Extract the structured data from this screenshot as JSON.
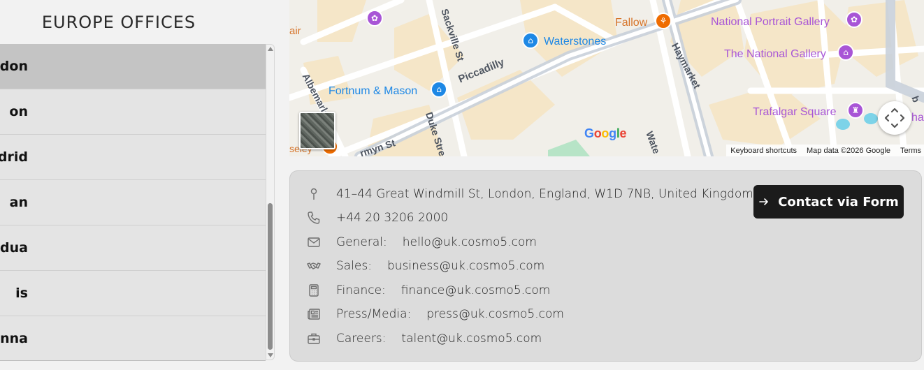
{
  "offices": {
    "title": "EUROPE OFFICES",
    "cities": [
      "ndon",
      "on",
      "drid",
      "an",
      "dua",
      "is",
      "nna"
    ],
    "active_index": 0
  },
  "map": {
    "labels": {
      "air": "air",
      "sackville": "Sackville St",
      "fallow": "Fallow",
      "waterstones": "Waterstones",
      "npg": "National Portrait Gallery",
      "tng": "The National Gallery",
      "haymarket": "Haymarket",
      "piccadilly": "Piccadilly",
      "fortnum": "Fortnum & Mason",
      "albemarle": "Albemarle St",
      "duke": "Duke Stre",
      "jermyn": "rmyn St",
      "trafalgar": "Trafalgar Square",
      "water": "Wate",
      "seley": "seley",
      "ha": "ha",
      "b": "b"
    },
    "google_logo": "Google",
    "attribution": {
      "shortcuts": "Keyboard shortcuts",
      "data": "Map data ©2026 Google",
      "terms": "Terms"
    }
  },
  "contact": {
    "address": "41–44 Great Windmill St, London, England, W1D 7NB, United Kingdom",
    "phone": "+44 20 3206 2000",
    "general_label": "General:",
    "general_email": "hello@uk.cosmo5.com",
    "sales_label": "Sales:",
    "sales_email": "business@uk.cosmo5.com",
    "finance_label": "Finance:",
    "finance_email": "finance@uk.cosmo5.com",
    "press_label": "Press/Media:",
    "press_email": "press@uk.cosmo5.com",
    "careers_label": "Careers:",
    "careers_email": "talent@uk.cosmo5.com",
    "button_label": "Contact via Form"
  },
  "colors": {
    "button_bg": "#1b1b1b",
    "poi_purple": "#a855d6",
    "poi_blue": "#1e88e5",
    "poi_orange": "#ef6c00"
  }
}
